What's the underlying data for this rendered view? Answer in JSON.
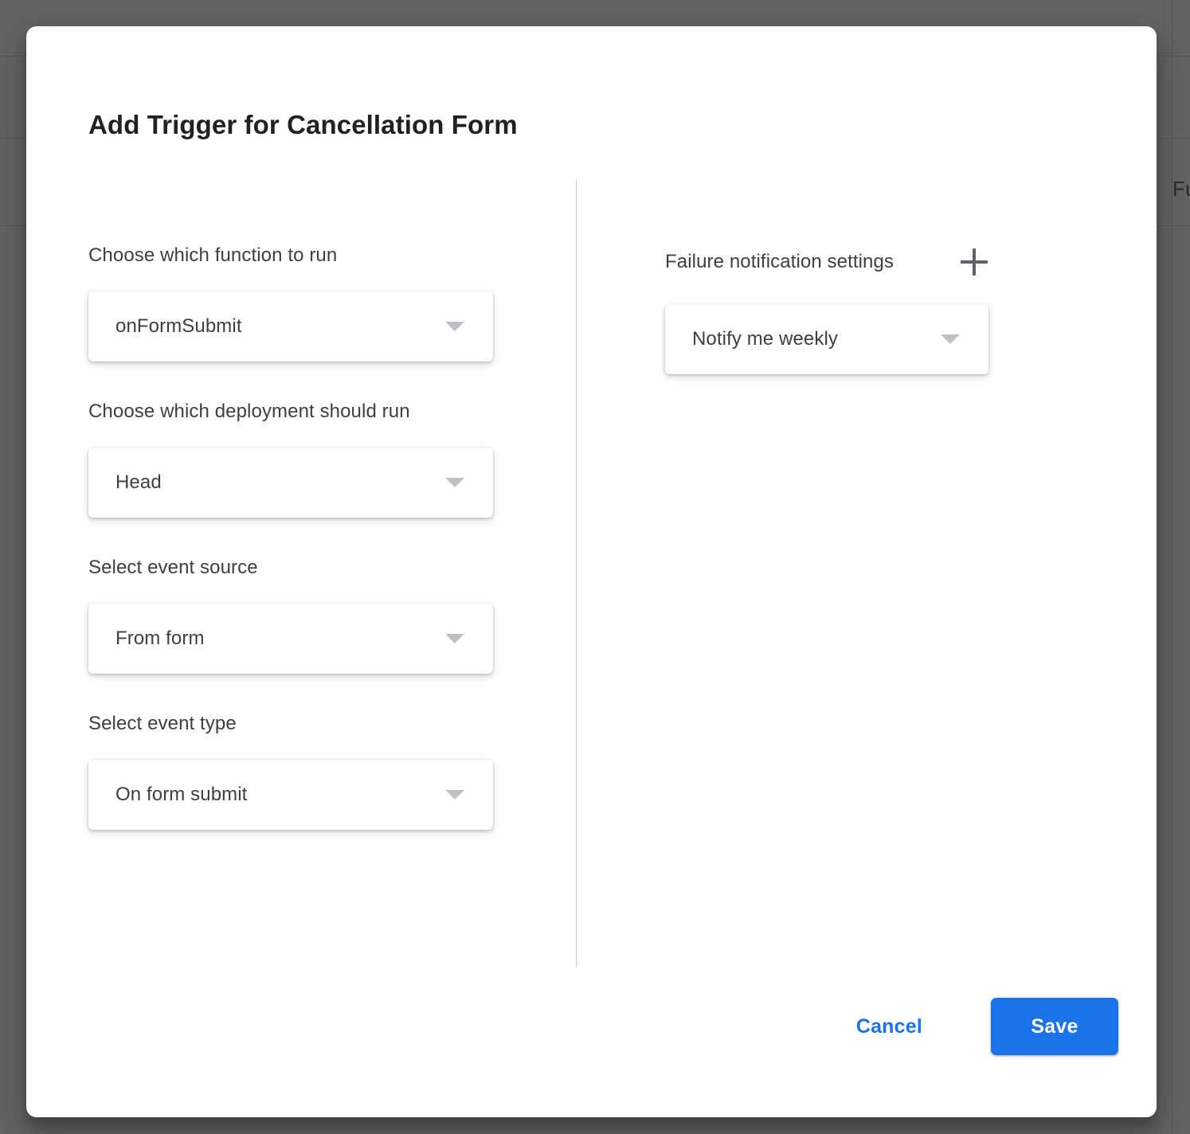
{
  "background": {
    "table_header_partial": "Fu",
    "overlay_color": "#636363",
    "row_line_color": "#545454"
  },
  "dialog": {
    "title": "Add Trigger for Cancellation Form",
    "left_column": {
      "fields": [
        {
          "label": "Choose which function to run",
          "value": "onFormSubmit",
          "caret_icon": "chevron-down-icon"
        },
        {
          "label": "Choose which deployment should run",
          "value": "Head",
          "caret_icon": "chevron-down-icon"
        },
        {
          "label": "Select event source",
          "value": "From form",
          "caret_icon": "chevron-down-icon"
        },
        {
          "label": "Select event type",
          "value": "On form submit",
          "caret_icon": "chevron-down-icon"
        }
      ]
    },
    "right_column": {
      "heading": "Failure notification settings",
      "add_icon": "plus-icon",
      "notification": {
        "value": "Notify me weekly",
        "caret_icon": "chevron-down-icon"
      }
    },
    "actions": {
      "cancel_label": "Cancel",
      "save_label": "Save"
    },
    "colors": {
      "accent": "#1a73e8",
      "text_primary": "#202124",
      "text_secondary": "#3c4043",
      "caret": "#bdc1c6",
      "divider": "#c4c9cd"
    }
  }
}
